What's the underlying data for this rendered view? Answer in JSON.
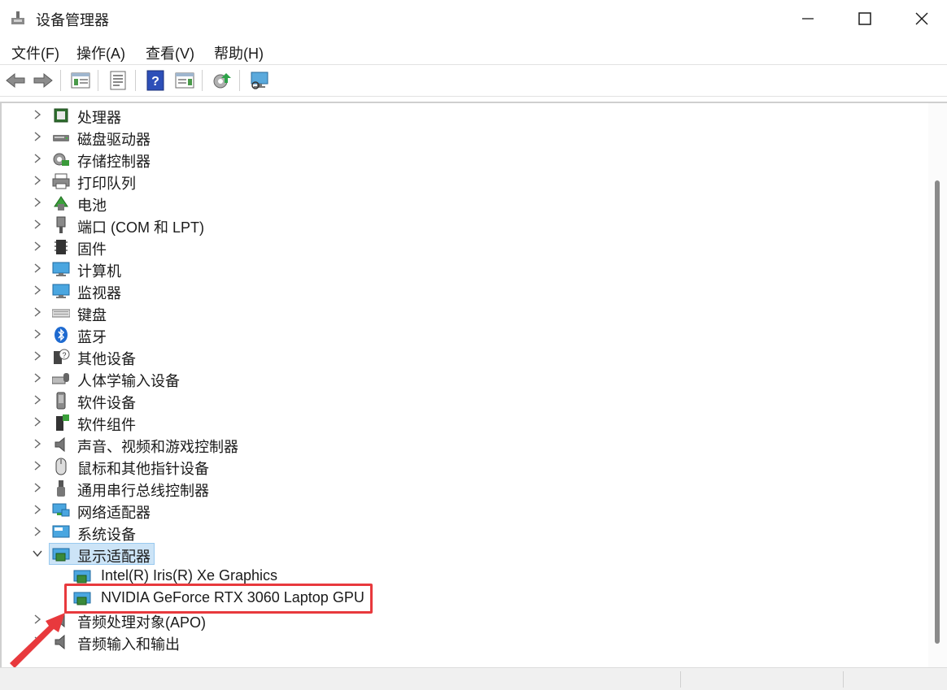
{
  "window": {
    "title": "设备管理器",
    "controls": [
      "minimize",
      "maximize",
      "close"
    ]
  },
  "menu": [
    {
      "label": "文件(F)"
    },
    {
      "label": "操作(A)"
    },
    {
      "label": "查看(V)"
    },
    {
      "label": "帮助(H)"
    }
  ],
  "toolbar": {
    "buttons": [
      "back-icon",
      "forward-icon",
      "properties-view-icon",
      "list-icon",
      "help-icon",
      "action-view-icon",
      "update-driver-icon",
      "monitor-scan-icon"
    ]
  },
  "tree": {
    "categories": [
      {
        "label": "处理器",
        "icon": "processor-icon"
      },
      {
        "label": "磁盘驱动器",
        "icon": "disk-icon"
      },
      {
        "label": "存储控制器",
        "icon": "storage-icon"
      },
      {
        "label": "打印队列",
        "icon": "printer-icon"
      },
      {
        "label": "电池",
        "icon": "battery-icon"
      },
      {
        "label": "端口 (COM 和 LPT)",
        "icon": "port-icon"
      },
      {
        "label": "固件",
        "icon": "firmware-icon"
      },
      {
        "label": "计算机",
        "icon": "computer-icon"
      },
      {
        "label": "监视器",
        "icon": "monitor-icon"
      },
      {
        "label": "键盘",
        "icon": "keyboard-icon"
      },
      {
        "label": "蓝牙",
        "icon": "bluetooth-icon"
      },
      {
        "label": "其他设备",
        "icon": "unknown-device-icon"
      },
      {
        "label": "人体学输入设备",
        "icon": "hid-icon"
      },
      {
        "label": "软件设备",
        "icon": "software-device-icon"
      },
      {
        "label": "软件组件",
        "icon": "software-component-icon"
      },
      {
        "label": "声音、视频和游戏控制器",
        "icon": "speaker-icon"
      },
      {
        "label": "鼠标和其他指针设备",
        "icon": "mouse-icon"
      },
      {
        "label": "通用串行总线控制器",
        "icon": "usb-icon"
      },
      {
        "label": "网络适配器",
        "icon": "network-icon"
      },
      {
        "label": "系统设备",
        "icon": "system-icon"
      },
      {
        "label": "显示适配器",
        "icon": "display-adapter-icon",
        "expanded": true,
        "selected": true
      }
    ],
    "display_children": [
      {
        "label": "Intel(R) Iris(R) Xe Graphics",
        "icon": "display-adapter-icon"
      },
      {
        "label": "NVIDIA GeForce RTX 3060 Laptop GPU",
        "icon": "display-adapter-icon",
        "highlighted": true
      }
    ],
    "after": [
      {
        "label": "音频处理对象(APO)",
        "icon": "speaker-icon"
      },
      {
        "label": "音频输入和输出",
        "icon": "speaker-icon"
      }
    ]
  },
  "colors": {
    "selection_bg": "#cce4f7",
    "highlight_red": "#e8393d"
  }
}
